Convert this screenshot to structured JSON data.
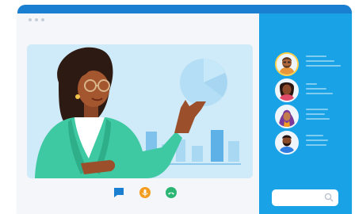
{
  "window": {
    "title_dots": 3
  },
  "stage": {
    "presenter": "woman-presenter",
    "slide": "slide-chart"
  },
  "controls": [
    {
      "name": "chat-button",
      "icon": "chat-bubble-icon",
      "color": "#1a7fd1"
    },
    {
      "name": "mute-button",
      "icon": "microphone-icon",
      "color": "#f39c1f"
    },
    {
      "name": "hangup-button",
      "icon": "phone-icon",
      "color": "#2bb673"
    }
  ],
  "participants": [
    {
      "name": "participant-1",
      "active": true
    },
    {
      "name": "participant-2",
      "active": false
    },
    {
      "name": "participant-3",
      "active": false
    },
    {
      "name": "participant-4",
      "active": false
    }
  ],
  "search": {
    "placeholder": ""
  },
  "colors": {
    "topbar": "#1a7fd1",
    "sidebar": "#19a2e6",
    "active_ring": "#ffd24a",
    "presenter_top": "#3ec9a2"
  }
}
